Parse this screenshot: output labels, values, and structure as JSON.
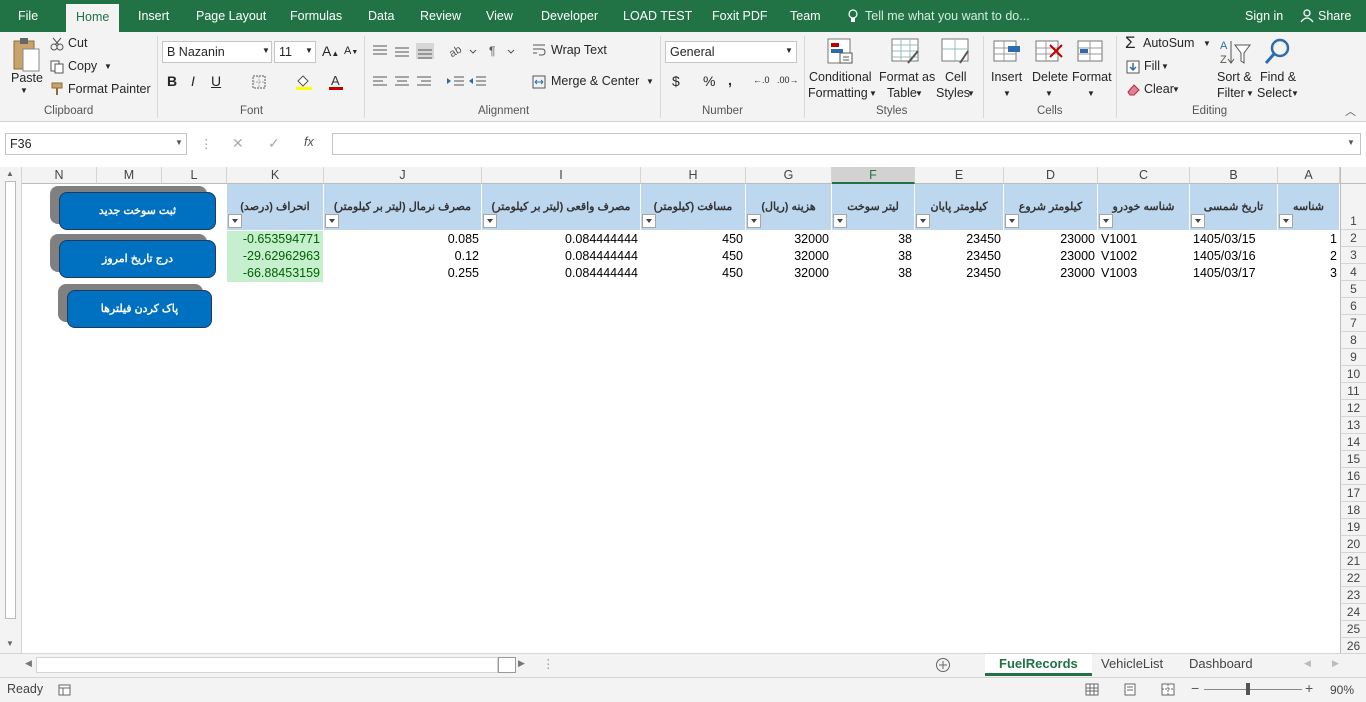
{
  "ribbon_tabs": [
    "File",
    "Home",
    "Insert",
    "Page Layout",
    "Formulas",
    "Data",
    "Review",
    "View",
    "Developer",
    "LOAD TEST",
    "Foxit PDF",
    "Team"
  ],
  "tell_me": "Tell me what you want to do...",
  "sign_in": "Sign in",
  "share": "Share",
  "clipboard": {
    "paste": "Paste",
    "cut": "Cut",
    "copy": "Copy",
    "format_painter": "Format Painter",
    "label": "Clipboard"
  },
  "font": {
    "name": "B Nazanin",
    "size": "11",
    "bold": "B",
    "italic": "I",
    "underline": "U",
    "label": "Font"
  },
  "alignment": {
    "wrap_text": "Wrap Text",
    "merge_center": "Merge & Center",
    "label": "Alignment"
  },
  "number": {
    "format": "General",
    "currency": "$",
    "percent": "%",
    "comma": ",",
    "label": "Number"
  },
  "styles": {
    "conditional": "Conditional",
    "conditional2": "Formatting",
    "format_as": "Format as",
    "format_as2": "Table",
    "cell": "Cell",
    "cell2": "Styles",
    "label": "Styles"
  },
  "cells": {
    "insert": "Insert",
    "delete": "Delete",
    "format": "Format",
    "label": "Cells"
  },
  "editing": {
    "autosum": "AutoSum",
    "fill": "Fill",
    "clear": "Clear",
    "sort": "Sort &",
    "sort2": "Filter",
    "find": "Find &",
    "find2": "Select",
    "label": "Editing"
  },
  "formula_bar": {
    "name_box": "F36",
    "fx": "fx",
    "value": ""
  },
  "columns": [
    "N",
    "M",
    "L",
    "K",
    "J",
    "I",
    "H",
    "G",
    "F",
    "E",
    "D",
    "C",
    "B",
    "A"
  ],
  "rows": [
    "1",
    "2",
    "3",
    "4",
    "5",
    "6",
    "7",
    "8",
    "9",
    "10",
    "11",
    "12",
    "13",
    "14",
    "15",
    "16",
    "17",
    "18",
    "19",
    "20",
    "21",
    "22",
    "23",
    "24",
    "25",
    "26"
  ],
  "table": {
    "headers": {
      "K": "انحراف (درصد)",
      "J": "مصرف نرمال (لیتر بر کیلومتر)",
      "I": "مصرف واقعی (لیتر بر کیلومتر)",
      "H": "مسافت (کیلومتر)",
      "G": "هزینه (ریال)",
      "F": "لیتر سوخت",
      "E": "کیلومتر پایان",
      "D": "کیلومتر شروع",
      "C": "شناسه خودرو",
      "B": "تاریخ شمسی",
      "A": "شناسه"
    },
    "rows": [
      {
        "K": "-0.653594771",
        "J": "0.085",
        "I": "0.084444444",
        "H": "450",
        "G": "32000",
        "F": "38",
        "E": "23450",
        "D": "23000",
        "C": "V1001",
        "B": "1405/03/15",
        "A": "1"
      },
      {
        "K": "-29.62962963",
        "J": "0.12",
        "I": "0.084444444",
        "H": "450",
        "G": "32000",
        "F": "38",
        "E": "23450",
        "D": "23000",
        "C": "V1002",
        "B": "1405/03/16",
        "A": "2"
      },
      {
        "K": "-66.88453159",
        "J": "0.255",
        "I": "0.084444444",
        "H": "450",
        "G": "32000",
        "F": "38",
        "E": "23450",
        "D": "23000",
        "C": "V1003",
        "B": "1405/03/17",
        "A": "3"
      }
    ]
  },
  "buttons": {
    "new_fuel": "ثبت سوخت جدید",
    "insert_today": "درج تاریخ امروز",
    "clear_filters": "پاک کردن فیلترها"
  },
  "sheet_tabs": [
    "FuelRecords",
    "VehicleList",
    "Dashboard"
  ],
  "active_sheet": "FuelRecords",
  "status": {
    "ready": "Ready",
    "zoom": "90%"
  },
  "colors": {
    "excel_green": "#217346",
    "header_fill": "#bdd7ee",
    "good_fill": "#c6efce",
    "good_text": "#006100",
    "button_blue": "#0070c0"
  }
}
